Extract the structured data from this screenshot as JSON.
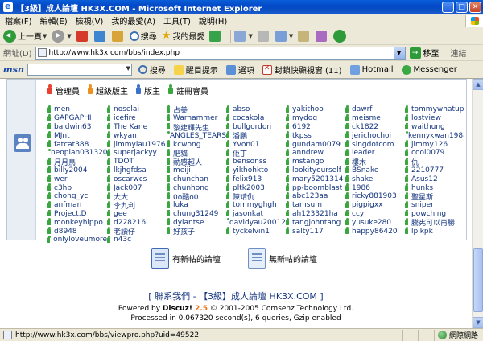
{
  "window": {
    "title": "【3級】成人論壇 HK3X.COM - Microsoft Internet Explorer",
    "btn_min": "_",
    "btn_max": "□",
    "btn_close": "✕"
  },
  "menu": [
    "檔案(F)",
    "編輯(E)",
    "檢視(V)",
    "我的最愛(A)",
    "工具(T)",
    "說明(H)"
  ],
  "toolbar": {
    "back": "上一頁",
    "search": "搜尋",
    "favorites": "我的最愛"
  },
  "address": {
    "label": "網址(D)",
    "url": "http://www.hk3x.com/bbs/index.php",
    "go": "移至",
    "links": "連結"
  },
  "msn": {
    "logo": "msn",
    "search": "搜尋",
    "highlight": "醒目提示",
    "options": "選項",
    "popup": "封鎖快顯視窗 (11)",
    "hotmail": "Hotmail",
    "messenger": "Messenger"
  },
  "legend": [
    {
      "label": "管理員",
      "role": "admin"
    },
    {
      "label": "超級版主",
      "role": "super"
    },
    {
      "label": "版主",
      "role": "mod"
    },
    {
      "label": "註冊會員",
      "role": "member"
    }
  ],
  "users": [
    "men",
    "noselai",
    "占美",
    "abso",
    "yakithoo",
    "dawrf",
    "tommywhatup",
    "GAPGAPHI",
    "icefire",
    "Warhammer",
    "cocakola",
    "mydog",
    "meisme",
    "lostview",
    "baldwin63",
    "The Kane",
    "黎建輝先生",
    "bullgordon",
    "6192",
    "ck1822",
    "waithung",
    "MJnt",
    "wkyan",
    "ANGLES_TEARS",
    "潘鵬",
    "tkpss",
    "jerichochoi",
    "kennykwan1988",
    "fatcat388",
    "jimmylau1976",
    "kcwong",
    "Yvon01",
    "gundam0079",
    "singdotcom",
    "jimmy126",
    "neoplan03132003",
    "superjackyy",
    "肥貓",
    "佢丁",
    "anndrew",
    "leader",
    "cool0079",
    "月月鳥",
    "TDOT",
    "動感超人",
    "bensonss",
    "mstango",
    "樓木",
    "仇",
    "billy2004",
    "lkjhgfdsa",
    "meiji",
    "yikhohkto",
    "lookityourself",
    "BSnake",
    "2210777",
    "wer",
    "oscarwcs",
    "chunchan",
    "felix913",
    "mary5201314",
    "shake",
    "Asus12",
    "c3hb",
    "Jack007",
    "chunhong",
    "pltk2003",
    "pp-boomblast",
    "1986",
    "hunks",
    "chong_yc",
    "大大",
    "0o酷o0",
    "陳靖仇",
    "abc123aa",
    "ricky881903",
    "聖星斯",
    "anfman",
    "李九利",
    "luka",
    "tommyghgh",
    "tamsum",
    "pigpigxx",
    "sniper",
    "Project.D",
    "gee",
    "chung31249",
    "jasonkat",
    "ah123321ha",
    "ccy",
    "powching",
    "monkeyhippo",
    "d228216",
    "dylantse",
    "davidyau2001235",
    "tangjohntang",
    "yusuke280",
    "騰宪可以再勝",
    "d8948",
    "老讀仔",
    "好孩子",
    "tyckelvin1",
    "salty117",
    "happy86420",
    "lplkpk",
    "onlyloveumore",
    "n43c"
  ],
  "forum_legend": {
    "new_posts": "有新帖的論壇",
    "no_new_posts": "無新帖的論壇"
  },
  "footer": {
    "contact": "聯系我們",
    "sep": " - ",
    "site": "【3級】成人論壇 HK3X.COM",
    "powered_prefix": "Powered by ",
    "product": "Discuz!",
    "version": " 2.5",
    "copyright": " © 2001-2005 Comsenz Technology Ltd.",
    "processed": "Processed in 0.067320 second(s), 6 queries, Gzip enabled"
  },
  "status": {
    "url": "http://www.hk3x.com/bbs/viewpro.php?uid=49522",
    "zone": "網際網路"
  }
}
